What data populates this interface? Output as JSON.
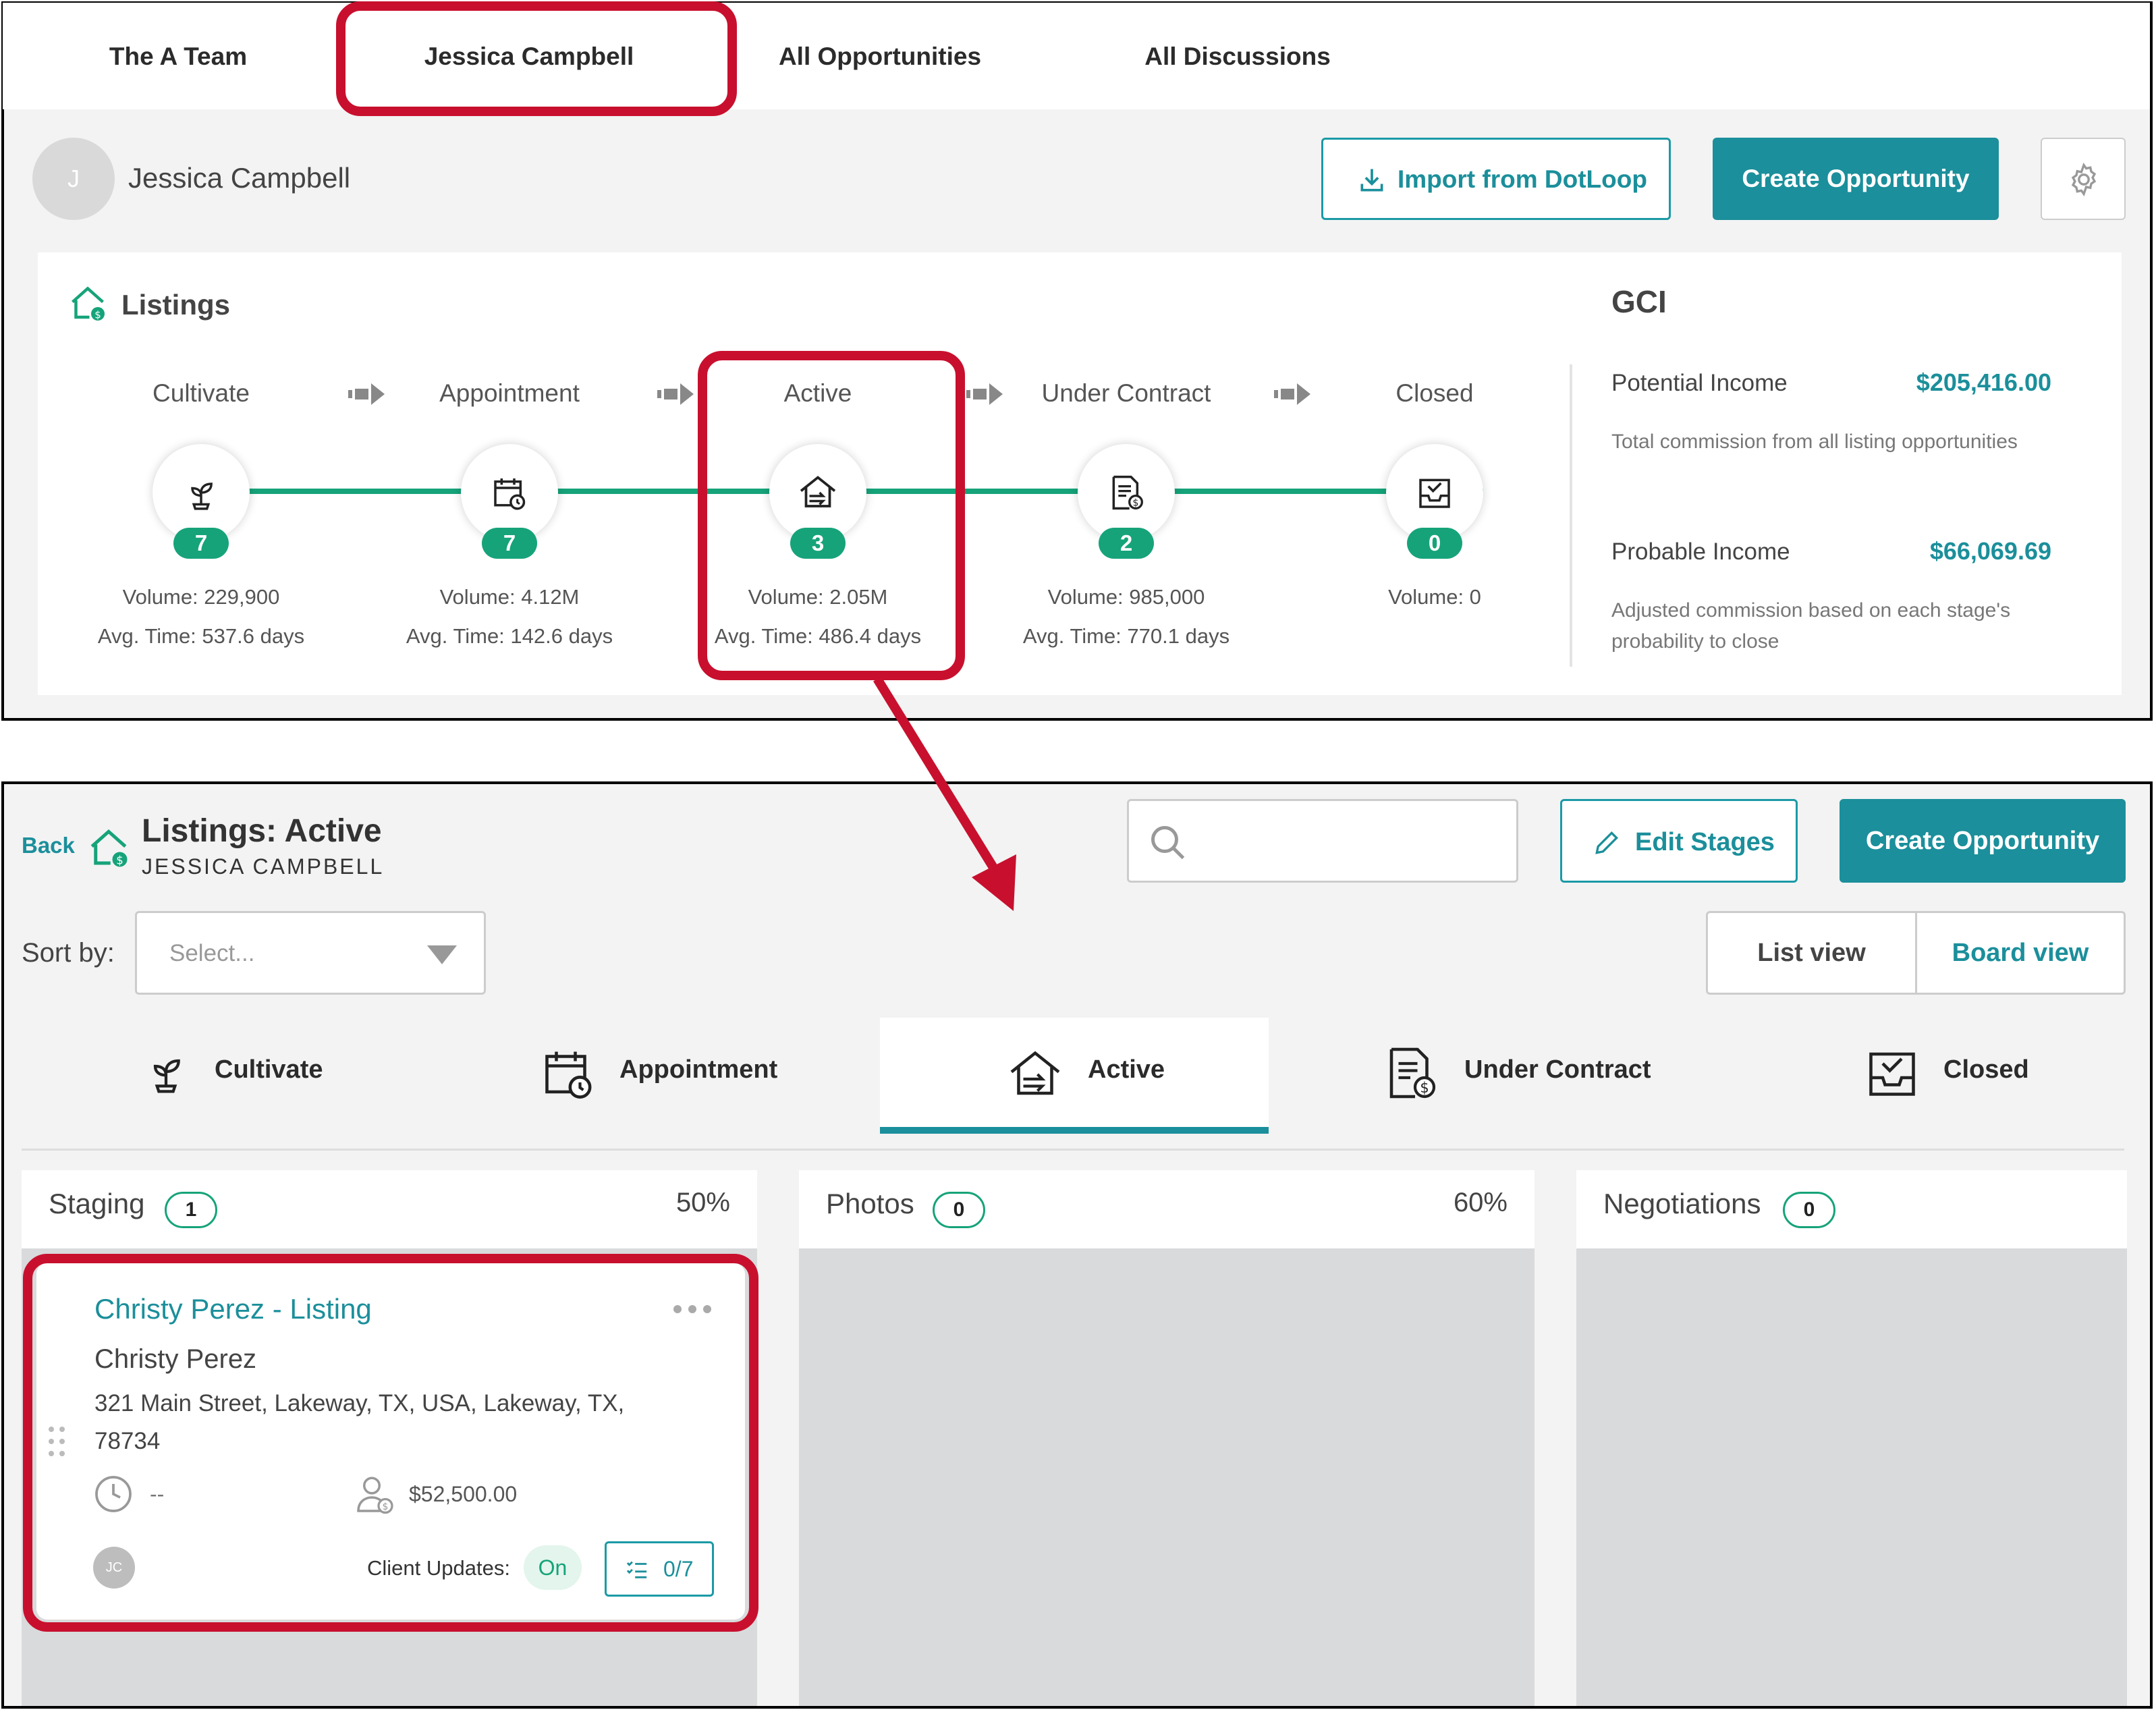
{
  "top": {
    "tabs": [
      "The A Team",
      "Jessica Campbell",
      "All Opportunities",
      "All Discussions"
    ],
    "user": {
      "initial": "J",
      "name": "Jessica Campbell"
    },
    "import_button": "Import from DotLoop",
    "create_button": "Create Opportunity",
    "listings_title": "Listings",
    "stages": [
      {
        "label": "Cultivate",
        "count": "7",
        "volume": "Volume: 229,900",
        "avg_time": "Avg. Time: 537.6 days",
        "icon": "plant-icon"
      },
      {
        "label": "Appointment",
        "count": "7",
        "volume": "Volume: 4.12M",
        "avg_time": "Avg. Time: 142.6 days",
        "icon": "calendar-clock-icon"
      },
      {
        "label": "Active",
        "count": "3",
        "volume": "Volume: 2.05M",
        "avg_time": "Avg. Time: 486.4 days",
        "icon": "house-arrow-icon"
      },
      {
        "label": "Under Contract",
        "count": "2",
        "volume": "Volume: 985,000",
        "avg_time": "Avg. Time: 770.1 days",
        "icon": "document-dollar-icon"
      },
      {
        "label": "Closed",
        "count": "0",
        "volume": "Volume: 0",
        "avg_time": "",
        "icon": "inbox-check-icon"
      }
    ],
    "gci": {
      "title": "GCI",
      "potential_label": "Potential Income",
      "potential_value": "$205,416.00",
      "potential_desc": "Total commission from all listing opportunities",
      "probable_label": "Probable Income",
      "probable_value": "$66,069.69",
      "probable_desc": "Adjusted commission based on each stage's probability to close"
    }
  },
  "bottom": {
    "back_label": "Back",
    "title": "Listings: Active",
    "subtitle": "JESSICA CAMPBELL",
    "search_placeholder": "",
    "edit_stages_button": "Edit Stages",
    "create_button": "Create Opportunity",
    "sort_label": "Sort by:",
    "sort_placeholder": "Select...",
    "list_view": "List view",
    "board_view": "Board view",
    "stage_tabs": [
      "Cultivate",
      "Appointment",
      "Active",
      "Under Contract",
      "Closed"
    ],
    "active_tab": "Active",
    "columns": [
      {
        "title": "Staging",
        "count": "1",
        "percent": "50%"
      },
      {
        "title": "Photos",
        "count": "0",
        "percent": "60%"
      },
      {
        "title": "Negotiations",
        "count": "0",
        "percent": ""
      }
    ],
    "card": {
      "title": "Christy Perez - Listing",
      "client": "Christy Perez",
      "address": "321 Main Street, Lakeway, TX, USA, Lakeway, TX, 78734",
      "date": "--",
      "commission": "$52,500.00",
      "assignee_initials": "JC",
      "client_updates_label": "Client Updates:",
      "client_updates_status": "On",
      "tasks": "0/7"
    }
  },
  "colors": {
    "accent": "#1b8f9b",
    "green": "#16a37a",
    "highlight": "#c8102e"
  }
}
